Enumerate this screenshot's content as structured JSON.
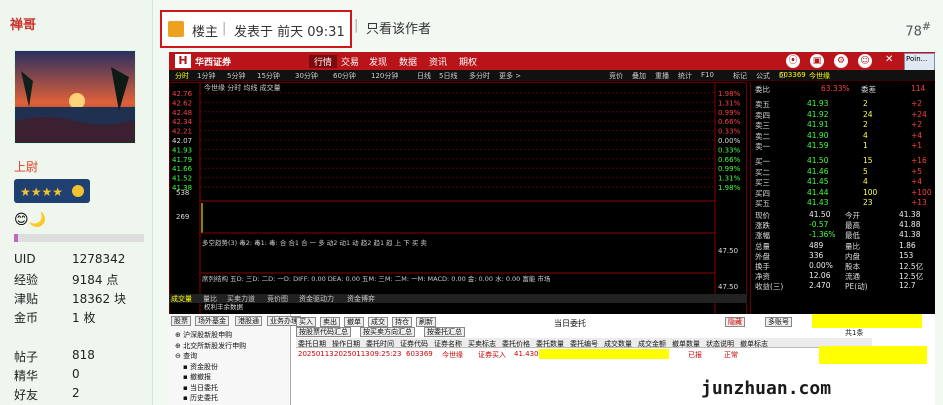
{
  "sidebar": {
    "username": "禅哥",
    "rank": "上尉",
    "stats": [
      {
        "label": "UID",
        "value": "1278342"
      },
      {
        "label": "经验",
        "value": "9184 点"
      },
      {
        "label": "津贴",
        "value": "18362 块"
      },
      {
        "label": "金币",
        "value": "1 枚"
      },
      {
        "label": "帖子",
        "value": "818"
      },
      {
        "label": "精华",
        "value": "0"
      },
      {
        "label": "好友",
        "value": "2"
      }
    ]
  },
  "post": {
    "role": "楼主",
    "posted": "发表于 前天 09:31",
    "only_author": "只看该作者",
    "floor": "78",
    "floor_mark": "#"
  },
  "app": {
    "brand": "华西证券",
    "menus": [
      "行情",
      "交易",
      "发现",
      "数据",
      "资讯",
      "期权"
    ],
    "timeframes": [
      "分时",
      "1分钟",
      "5分钟",
      "15分钟",
      "30分钟",
      "60分钟",
      "120分钟",
      "日线",
      "5日线",
      "多分时",
      "更多 >"
    ],
    "right_tools": [
      "竞价",
      "叠加",
      "重播",
      "统计",
      "F10",
      "标记",
      "公式",
      "□"
    ],
    "stock_code": "603369",
    "stock_name": "今世缘",
    "chart_header": "今世缘 分时 均线 成交量",
    "left_prices": [
      "42.76",
      "42.62",
      "42.48",
      "42.34",
      "42.21",
      "42.07",
      "41.93",
      "41.79",
      "41.66",
      "41.52",
      "41.38"
    ],
    "right_pcts": [
      "1.98%",
      "1.31%",
      "0.99%",
      "0.66%",
      "0.33%",
      "0.00%",
      "0.33%",
      "0.66%",
      "0.99%",
      "1.31%",
      "1.98%"
    ],
    "vol_labels": [
      "538",
      "269"
    ],
    "indicator_line": "多空趋势(3)  毒2: 毒1: 毒: 合 合1 合 一 多 动2 动1 动 趋2 趋1 趋 上 下 买 卖",
    "macd_line": "席列结构  五D: 三D: 二D: 一D: DIFF: 0.00 DEA: 0.00 五M: 三M: 二M: 一M: MACD: 0.00 金: 0.00 水: 0.00 富能 市场",
    "vol_note": "权利丰余数据",
    "times": [
      "09:30",
      "10:30",
      "13:00",
      "14:00",
      "15:00"
    ],
    "bottom_tabs": [
      "成交量",
      "量比",
      "买卖力道",
      "竞价图",
      "资金驱动力",
      "资金博弈"
    ],
    "quote_header": {
      "wb": "委比",
      "wb_val": "63.33%",
      "wc": "委差",
      "wc_val": "114"
    },
    "asks": [
      {
        "label": "卖五",
        "price": "41.93",
        "vol": "2",
        "chg": "+2"
      },
      {
        "label": "卖四",
        "price": "41.92",
        "vol": "24",
        "chg": "+24"
      },
      {
        "label": "卖三",
        "price": "41.91",
        "vol": "2",
        "chg": "+2"
      },
      {
        "label": "卖二",
        "price": "41.90",
        "vol": "4",
        "chg": "+4"
      },
      {
        "label": "卖一",
        "price": "41.59",
        "vol": "1",
        "chg": "+1"
      }
    ],
    "bids": [
      {
        "label": "买一",
        "price": "41.50",
        "vol": "15",
        "chg": "+16"
      },
      {
        "label": "买二",
        "price": "41.46",
        "vol": "5",
        "chg": "+5"
      },
      {
        "label": "买三",
        "price": "41.45",
        "vol": "4",
        "chg": "+4"
      },
      {
        "label": "买四",
        "price": "41.44",
        "vol": "100",
        "chg": "+100"
      },
      {
        "label": "买五",
        "price": "41.43",
        "vol": "23",
        "chg": "+13"
      }
    ],
    "stats": [
      {
        "l1": "现价",
        "v1": "41.50",
        "l2": "今开",
        "v2": "41.38"
      },
      {
        "l1": "涨跌",
        "v1": "-0.57",
        "l2": "最高",
        "v2": "41.88"
      },
      {
        "l1": "涨幅",
        "v1": "-1.36%",
        "l2": "最低",
        "v2": "41.38"
      },
      {
        "l1": "总量",
        "v1": "489",
        "l2": "量比",
        "v2": "1.86"
      },
      {
        "l1": "外盘",
        "v1": "336",
        "l2": "内盘",
        "v2": "153"
      },
      {
        "l1": "换手",
        "v1": "0.00%",
        "l2": "股本",
        "v2": "12.5亿"
      },
      {
        "l1": "净资",
        "v1": "12.06",
        "l2": "流通",
        "v2": "12.5亿"
      },
      {
        "l1": "收益(三)",
        "v1": "2.470",
        "l2": "PE(动)",
        "v2": "12.7"
      }
    ],
    "tree": {
      "tabs": [
        "股票",
        "场外基金",
        "港股通",
        "业务办理"
      ],
      "items": [
        "沪深股新股申购",
        "北交所新股发行申购",
        "查询",
        "资金股份",
        "撤撤报",
        "当日委托",
        "历史委托"
      ]
    },
    "order_btns": [
      "买入",
      "卖出",
      "撤单",
      "成交",
      "持仓",
      "刷新"
    ],
    "panel_title": "当日委托",
    "panel_right": [
      "隐藏",
      "多账号"
    ],
    "sub_tabs": [
      "按股票代码汇总",
      "按买卖方向汇总",
      "按委托汇总"
    ],
    "count_text": "共1条",
    "columns": [
      "委托日期",
      "操作日期",
      "委托时间",
      "证券代码",
      "证券名称",
      "买卖标志",
      "委托价格",
      "委托数量",
      "委托编号",
      "成交数量",
      "成交金额",
      "撤单数量",
      "状态说明",
      "撤单标志"
    ],
    "row": {
      "date": "20250113",
      "opdate": "20250113",
      "time": "09:25:23",
      "code": "603369",
      "name": "今世缘",
      "side": "证券买入",
      "price": "41.430",
      "status": "已报",
      "flag": "正常"
    }
  },
  "watermark": "junzhuan.com"
}
